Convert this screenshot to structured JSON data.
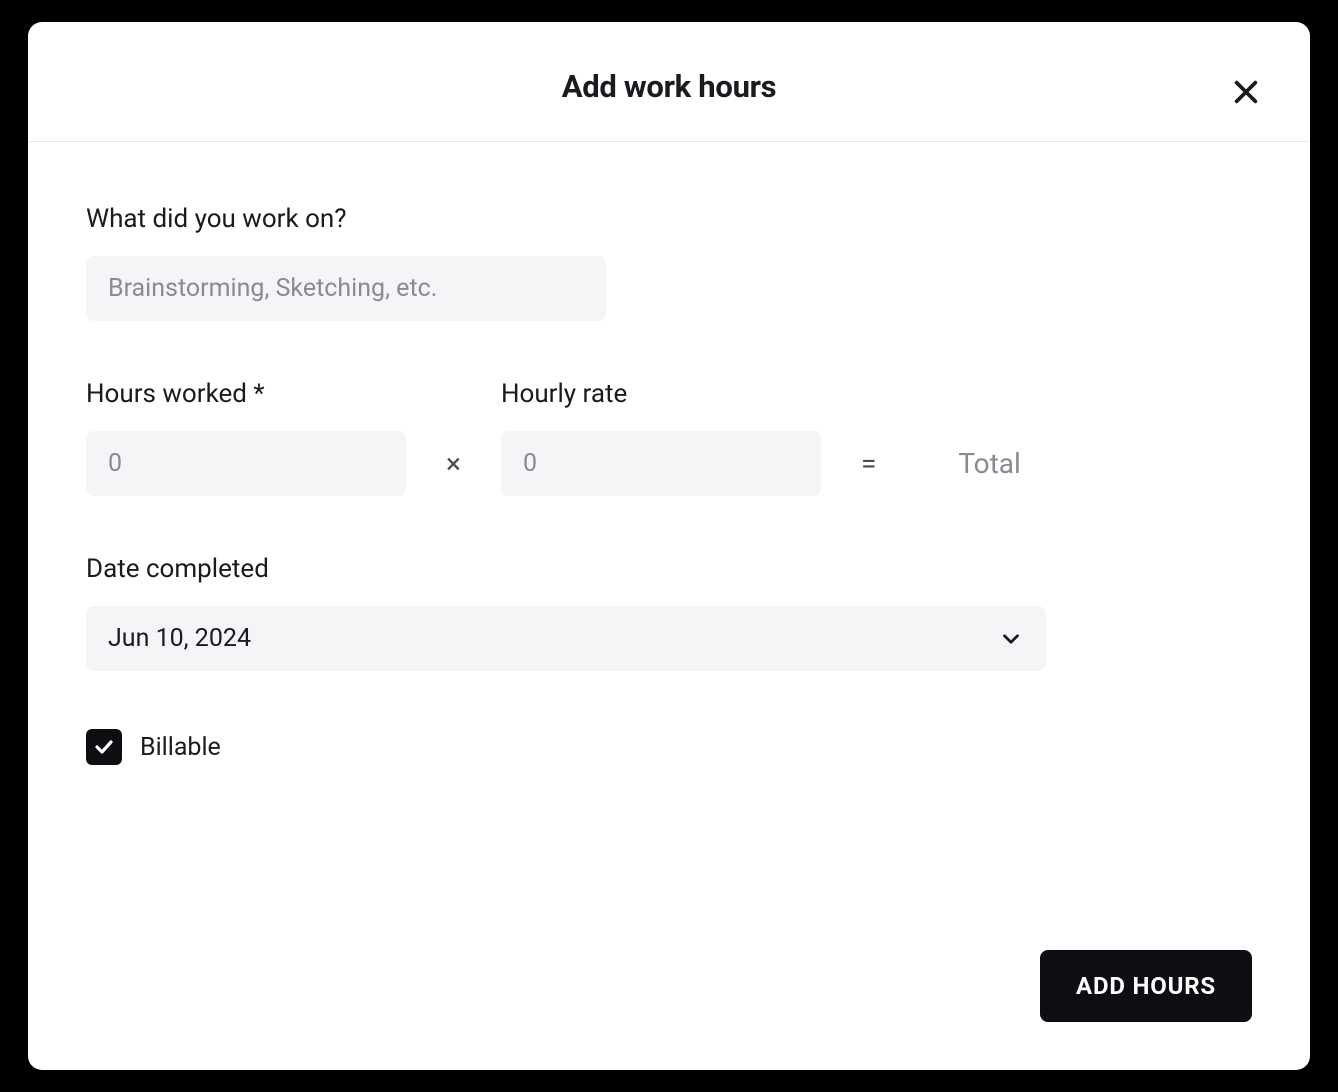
{
  "modal": {
    "title": "Add work hours",
    "fields": {
      "work_label": "What did you work on?",
      "work_placeholder": "Brainstorming, Sketching, etc.",
      "hours_label": "Hours worked *",
      "hours_placeholder": "0",
      "rate_label": "Hourly rate",
      "rate_placeholder": "0",
      "multiply_symbol": "×",
      "equals_symbol": "=",
      "total_label": "Total",
      "date_label": "Date completed",
      "date_value": "Jun 10, 2024",
      "billable_label": "Billable",
      "billable_checked": true
    },
    "submit_label": "ADD HOURS"
  }
}
